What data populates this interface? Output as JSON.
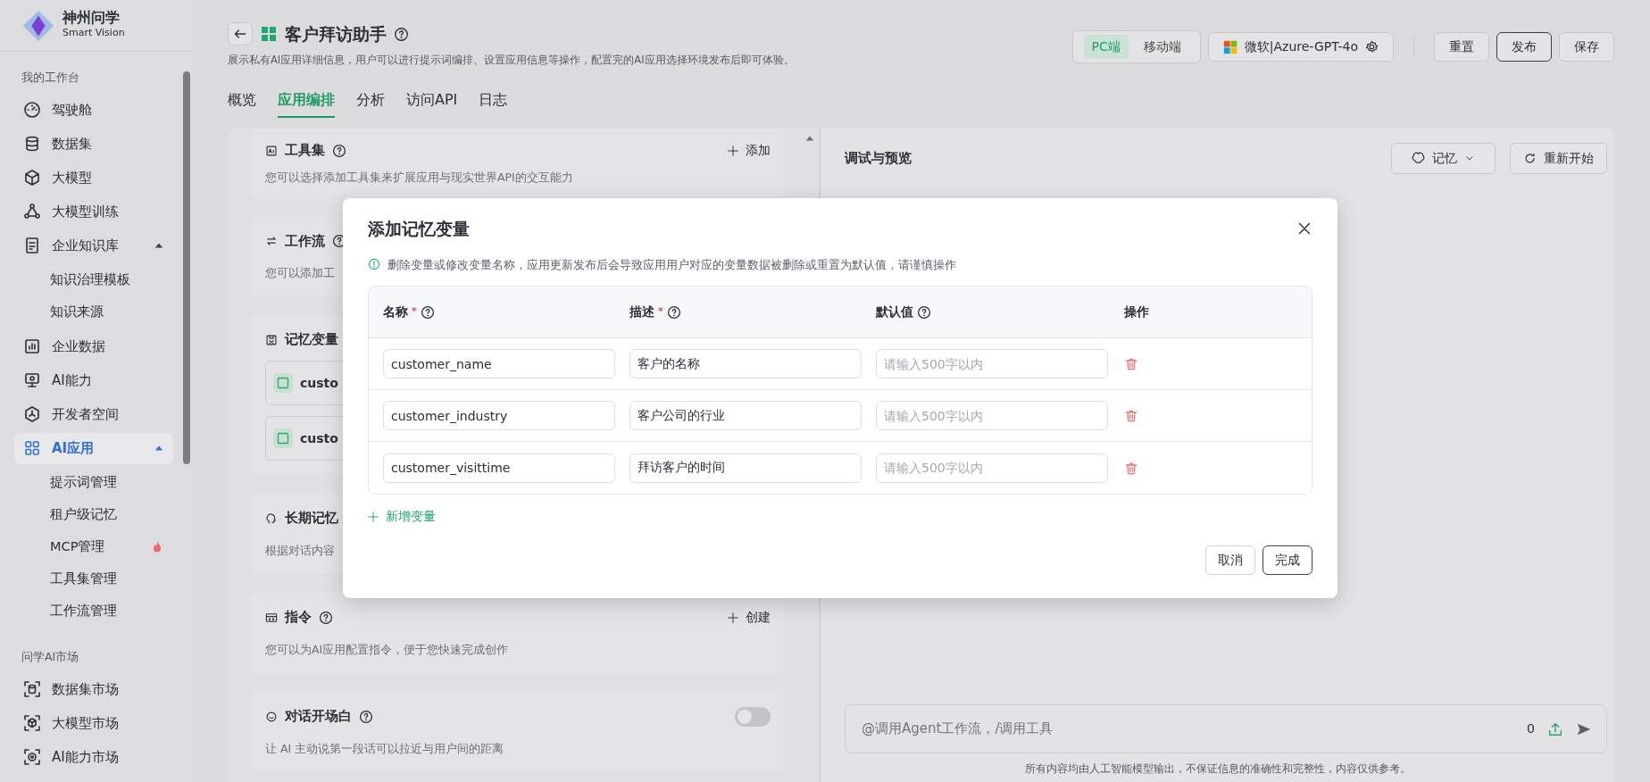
{
  "app": {
    "logo_title": "神州问学",
    "logo_subtitle": "Smart Vision"
  },
  "sidebar": {
    "sections": [
      {
        "title": "我的工作台",
        "items": [
          {
            "label": "驾驶舱",
            "selected": false
          },
          {
            "label": "数据集",
            "selected": false
          },
          {
            "label": "大模型",
            "selected": false
          },
          {
            "label": "大模型训练",
            "selected": false
          },
          {
            "label": "企业知识库",
            "selected": false,
            "expanded": true,
            "children": [
              {
                "label": "知识治理模板",
                "hot": false
              },
              {
                "label": "知识来源",
                "hot": false
              }
            ]
          },
          {
            "label": "企业数据",
            "selected": false
          },
          {
            "label": "AI能力",
            "selected": false
          },
          {
            "label": "开发者空间",
            "selected": false
          },
          {
            "label": "AI应用",
            "selected": true,
            "expanded": true,
            "children": [
              {
                "label": "提示词管理",
                "hot": false
              },
              {
                "label": "租户级记忆",
                "hot": false
              },
              {
                "label": "MCP管理",
                "hot": true
              },
              {
                "label": "工具集管理",
                "hot": false
              },
              {
                "label": "工作流管理",
                "hot": false
              }
            ]
          }
        ]
      },
      {
        "title": "问学AI市场",
        "items": [
          {
            "label": "数据集市场",
            "selected": false
          },
          {
            "label": "大模型市场",
            "selected": false
          },
          {
            "label": "AI能力市场",
            "selected": false
          }
        ]
      }
    ]
  },
  "header": {
    "title": "客户拜访助手",
    "subtitle": "展示私有AI应用详细信息，用户可以进行提示词编排、设置应用信息等操作，配置完的AI应用选择环境发布后即可体验。",
    "platforms": [
      {
        "label": "PC端",
        "selected": true
      },
      {
        "label": "移动端",
        "selected": false
      }
    ],
    "model": "微软|Azure-GPT-4o",
    "buttons": [
      {
        "label": "重置",
        "emphasized": false
      },
      {
        "label": "发布",
        "emphasized": true
      },
      {
        "label": "保存",
        "emphasized": false
      }
    ]
  },
  "tabs": [
    {
      "label": "概览",
      "selected": false
    },
    {
      "label": "应用编排",
      "selected": true
    },
    {
      "label": "分析",
      "selected": false
    },
    {
      "label": "访问API",
      "selected": false
    },
    {
      "label": "日志",
      "selected": false
    }
  ],
  "config_sections": [
    {
      "title": "工具集",
      "help": true,
      "action": "添加",
      "description": "您可以选择添加工具集来扩展应用与现实世界API的交互能力"
    },
    {
      "title": "工作流",
      "help": true,
      "description": "您可以添加工"
    },
    {
      "title": "记忆变量",
      "help": false,
      "variables": [
        "custo",
        "custo"
      ]
    },
    {
      "title": "长期记忆",
      "help": false,
      "description": "根据对话内容"
    },
    {
      "title": "指令",
      "help": true,
      "action": "创建",
      "description": "您可以为AI应用配置指令，便于您快速完成创作"
    },
    {
      "title": "对话开场白",
      "help": true,
      "toggle": {
        "on": false
      },
      "description": "让 AI 主动说第一段话可以拉近与用户间的距离"
    }
  ],
  "preview": {
    "title": "调试与预览",
    "memory_button": "记忆",
    "restart_button": "重新开始",
    "input_placeholder": "@调用Agent工作流，/调用工具",
    "counter": "0",
    "disclaimer": "所有内容均由人工智能模型输出，不保证信息的准确性和完整性，内容仅供参考。"
  },
  "dialog": {
    "title": "添加记忆变量",
    "warning": "删除变量或修改变量名称，应用更新发布后会导致应用用户对应的变量数据被删除或重置为默认值，请谨慎操作",
    "columns": [
      {
        "label": "名称",
        "required": true,
        "help": true
      },
      {
        "label": "描述",
        "required": true,
        "help": true
      },
      {
        "label": "默认值",
        "required": false,
        "help": true
      },
      {
        "label": "操作",
        "required": false,
        "help": false
      }
    ],
    "rows": [
      {
        "name": "customer_name",
        "description": "客户的名称",
        "default_placeholder": "请输入500字以内"
      },
      {
        "name": "customer_industry",
        "description": "客户公司的行业",
        "default_placeholder": "请输入500字以内"
      },
      {
        "name": "customer_visittime",
        "description": "拜访客户的时间",
        "default_placeholder": "请输入500字以内"
      }
    ],
    "required_symbol": "*",
    "add_button": "新增变量",
    "cancel_button": "取消",
    "confirm_button": "完成"
  }
}
